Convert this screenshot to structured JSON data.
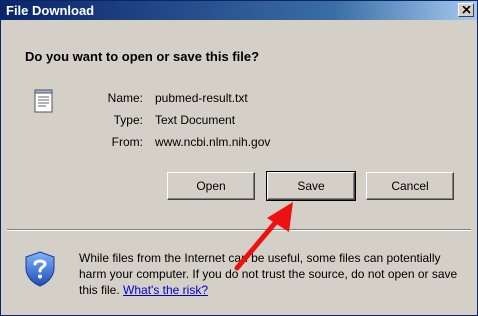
{
  "dialog": {
    "title": "File Download",
    "question": "Do you want to open or save this file?",
    "file_icon": "text-document-icon",
    "info": [
      {
        "label": "Name:",
        "value": "pubmed-result.txt"
      },
      {
        "label": "Type:",
        "value": "Text Document"
      },
      {
        "label": "From:",
        "value": "www.ncbi.nlm.nih.gov"
      }
    ],
    "buttons": {
      "open": "Open",
      "save": "Save",
      "cancel": "Cancel"
    },
    "warning": {
      "icon": "shield-question-icon",
      "text": "While files from the Internet can be useful, some files can potentially harm your computer. If you do not trust the source, do not open or save this file.",
      "link": "What's the risk?"
    },
    "annotation": {
      "icon": "red-arrow-icon",
      "color": "#ee1111"
    }
  },
  "colors": {
    "titlebar_start": "#0a246a",
    "titlebar_end": "#a6caf0",
    "dialog_bg": "#d4d0c8",
    "link": "#0000cc"
  }
}
